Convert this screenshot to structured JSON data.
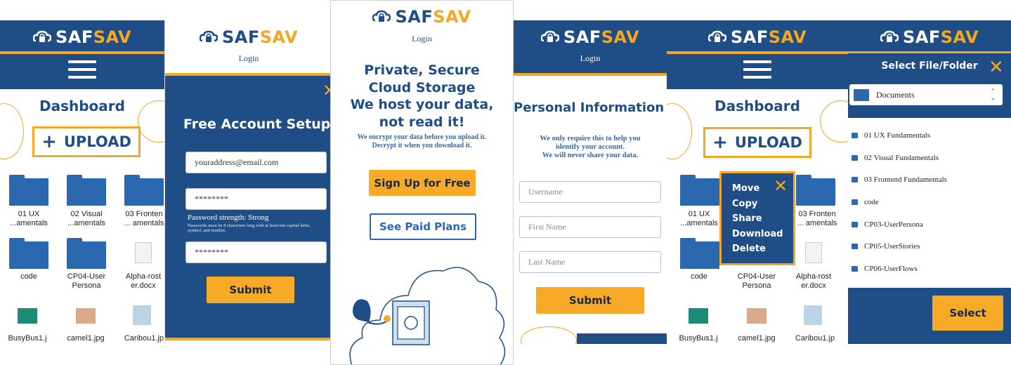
{
  "brand": {
    "part1": "SAF",
    "part2": "SAV"
  },
  "colors": {
    "navy": "#1f4e86",
    "orange": "#f5a623",
    "folder": "#2c68b0"
  },
  "screen1": {
    "title": "Dashboard",
    "upload_label": "UPLOAD",
    "files": [
      {
        "name": "01 UX\n...amentals",
        "type": "folder"
      },
      {
        "name": "02 Visual\n...amentals",
        "type": "folder"
      },
      {
        "name": "03 Fronten\n... amentals",
        "type": "folder"
      },
      {
        "name": "code",
        "type": "folder"
      },
      {
        "name": "CP04-User\nPersona",
        "type": "folder"
      },
      {
        "name": "Alpha-rost\ner.docx",
        "type": "doc"
      },
      {
        "name": "BusyBus1.j",
        "type": "image"
      },
      {
        "name": "camel1.jpg",
        "type": "image"
      },
      {
        "name": "Caribou1.jp",
        "type": "image"
      }
    ]
  },
  "screen2": {
    "login_link": "Login",
    "heading": "Free Account Setup",
    "email_value": "youraddress@email.com",
    "password_value": "********",
    "password_strength": "Password strength: Strong",
    "password_hint": "Passwords must be 8 characters long with at least one capital letter, symbol, and number.",
    "confirm_value": "********",
    "submit_label": "Submit"
  },
  "screen3": {
    "login_link": "Login",
    "headline_1": "Private, Secure",
    "headline_2": "Cloud Storage",
    "headline_3": "We host your data,",
    "headline_4": "not read it!",
    "sub_1": "We encrypt your data before you upload it.",
    "sub_2": "Decrypt it when you download it.",
    "signup_label": "Sign Up for Free",
    "paid_label": "See Paid Plans"
  },
  "screen4": {
    "login_link": "Login",
    "heading": "Personal Information",
    "note_1": "We only require this to help you",
    "note_2": "identify your account.",
    "note_3": "We will never share your data.",
    "username_placeholder": "Username",
    "firstname_placeholder": "First Name",
    "lastname_placeholder": "Last Name",
    "submit_label": "Submit"
  },
  "screen5": {
    "title": "Dashboard",
    "upload_label": "UPLOAD",
    "context_menu": [
      "Move",
      "Copy",
      "Share",
      "Download",
      "Delete"
    ],
    "files": [
      {
        "name": "01 UX\n...amentals"
      },
      {
        "name": "03 Fronten\n... amentals"
      },
      {
        "name": "code"
      },
      {
        "name": "CP04-User\nPersona"
      },
      {
        "name": "Alpha-rost\ner.docx"
      },
      {
        "name": "BusyBus1.j"
      },
      {
        "name": "camel1.jpg"
      },
      {
        "name": "Caribou1.jp"
      }
    ]
  },
  "screen6": {
    "title": "Select File/Folder",
    "current_folder": "Documents",
    "items": [
      "01 UX Fundamentals",
      "02 Visual Fundamentals",
      "03 Frontend Fundamentals",
      "code",
      "CP03-UserPersona",
      "CP05-UserStories",
      "CP06-UserFlows"
    ],
    "select_label": "Select"
  }
}
